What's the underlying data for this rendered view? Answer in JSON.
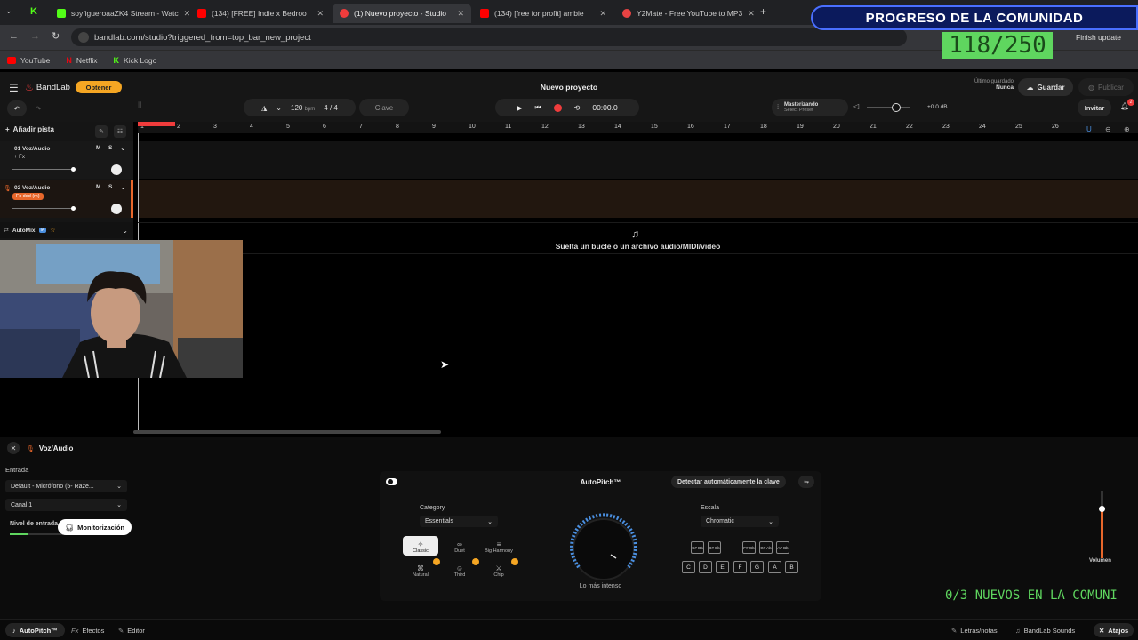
{
  "browser": {
    "tabs": [
      {
        "label": "soyfigueroaaZK4 Stream - Watc",
        "color": "#53fc18"
      },
      {
        "label": "(134) [FREE] Indie x Bedroo",
        "color": "#ff0000"
      },
      {
        "label": "(1) Nuevo proyecto - Studio",
        "color": "#f03c3c"
      },
      {
        "label": "(134) [free for profit] ambie",
        "color": "#ff0000"
      },
      {
        "label": "Y2Mate - Free YouTube to MP3",
        "color": "#e84343"
      }
    ],
    "url": "bandlab.com/studio?triggered_from=top_bar_new_project",
    "finish_update": "Finish update",
    "bookmarks": [
      "YouTube",
      "Netflix",
      "Kick Logo"
    ]
  },
  "overlay": {
    "banner": "PROGRESO DE LA COMUNIDAD",
    "counter": "118/250",
    "ticker": "0/3 NUEVOS EN LA COMUNI"
  },
  "app": {
    "logo": "BandLab",
    "get_button": "Obtener",
    "project_title": "Nuevo proyecto",
    "last_saved_label": "Último guardado",
    "last_saved_value": "Nunca",
    "save": "Guardar",
    "publish": "Publicar",
    "bpm_value": "120",
    "bpm_unit": "bpm",
    "time_sig": "4 / 4",
    "key": "Clave",
    "time": "00:00.0",
    "mastering_title": "Masterizando",
    "mastering_preset": "Select Preset",
    "volume_db": "+0.0 dB",
    "invite": "Invitar",
    "notif_count": "2",
    "add_track": "Añadir pista",
    "ruler": [
      "1",
      "2",
      "3",
      "4",
      "5",
      "6",
      "7",
      "8",
      "9",
      "10",
      "11",
      "12",
      "13",
      "14",
      "15",
      "16",
      "17",
      "18",
      "19",
      "20",
      "21",
      "22",
      "23",
      "24",
      "25",
      "26"
    ],
    "tracks": [
      {
        "name": "01  Voz/Audio",
        "fx": "+ Fx",
        "m": "M",
        "s": "S"
      },
      {
        "name": "02  Voz/Audio",
        "fx": "Fx  ddd (m)",
        "m": "M",
        "s": "S"
      }
    ],
    "automix": "AutoMix",
    "automix_badge": "IA",
    "drop_text": "Suelta un bucle o un archivo audio/MIDI/video"
  },
  "bottom": {
    "track_name": "Voz/Audio",
    "input_label": "Entrada",
    "input_device": "Default - Micrófono (5- Raze...",
    "channel": "Canal 1",
    "input_level": "Nivel de entrada",
    "monitor": "Monitorización",
    "autopitch": {
      "title": "AutoPitch™",
      "auto_key": "Detectar automáticamente la clave",
      "category_label": "Category",
      "category_value": "Essentials",
      "categories": [
        "Classic",
        "Duet",
        "Big Harmony",
        "Natural",
        "Third",
        "Chip"
      ],
      "knob_label": "Lo más intenso",
      "scale_label": "Escala",
      "scale_value": "Chromatic",
      "sharps": [
        "C# Db",
        "D# Eb",
        "F# Gb",
        "G# Ab",
        "A# Bb"
      ],
      "naturals": [
        "C",
        "D",
        "E",
        "F",
        "G",
        "A",
        "B"
      ]
    },
    "volume_label": "Volumen",
    "bottom_tabs": [
      "AutoPitch™",
      "Efectos",
      "Editor"
    ],
    "right_tabs": [
      "Letras/notas",
      "BandLab Sounds",
      "Atajos"
    ]
  },
  "colors": {
    "accent": "#f03c3c",
    "orange": "#e8672b",
    "gold": "#f5a623",
    "green": "#5fd65f",
    "blue": "#4a8fe0"
  }
}
